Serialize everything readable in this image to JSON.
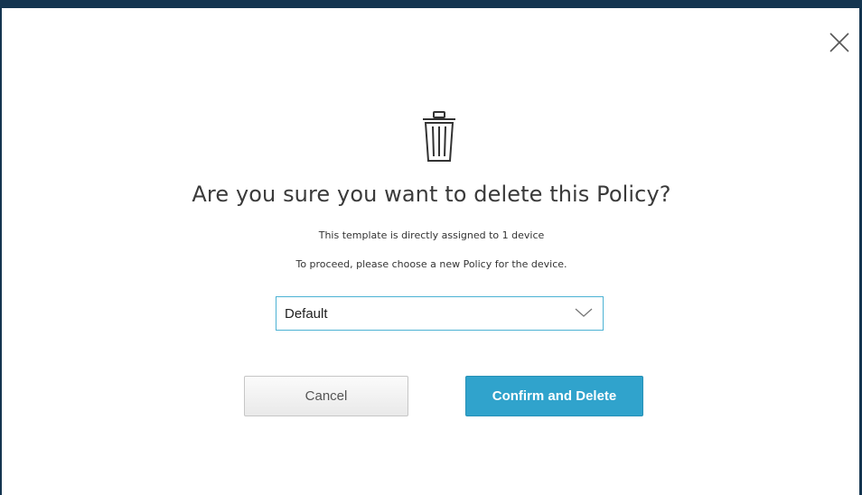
{
  "dialog": {
    "title": "Are you sure you want to delete this Policy?",
    "message_line1": "This template is directly assigned to 1 device",
    "message_line2": "To proceed, please choose a new Policy for the device.",
    "policy_select": {
      "selected": "Default"
    },
    "cancel_label": "Cancel",
    "confirm_label": "Confirm and Delete",
    "icons": {
      "close": "close-icon",
      "trash": "trash-icon",
      "dropdown": "chevron-down-icon"
    },
    "colors": {
      "accent": "#30a3cc",
      "backdrop": "#143550",
      "select_border": "#4cb2d4"
    }
  }
}
